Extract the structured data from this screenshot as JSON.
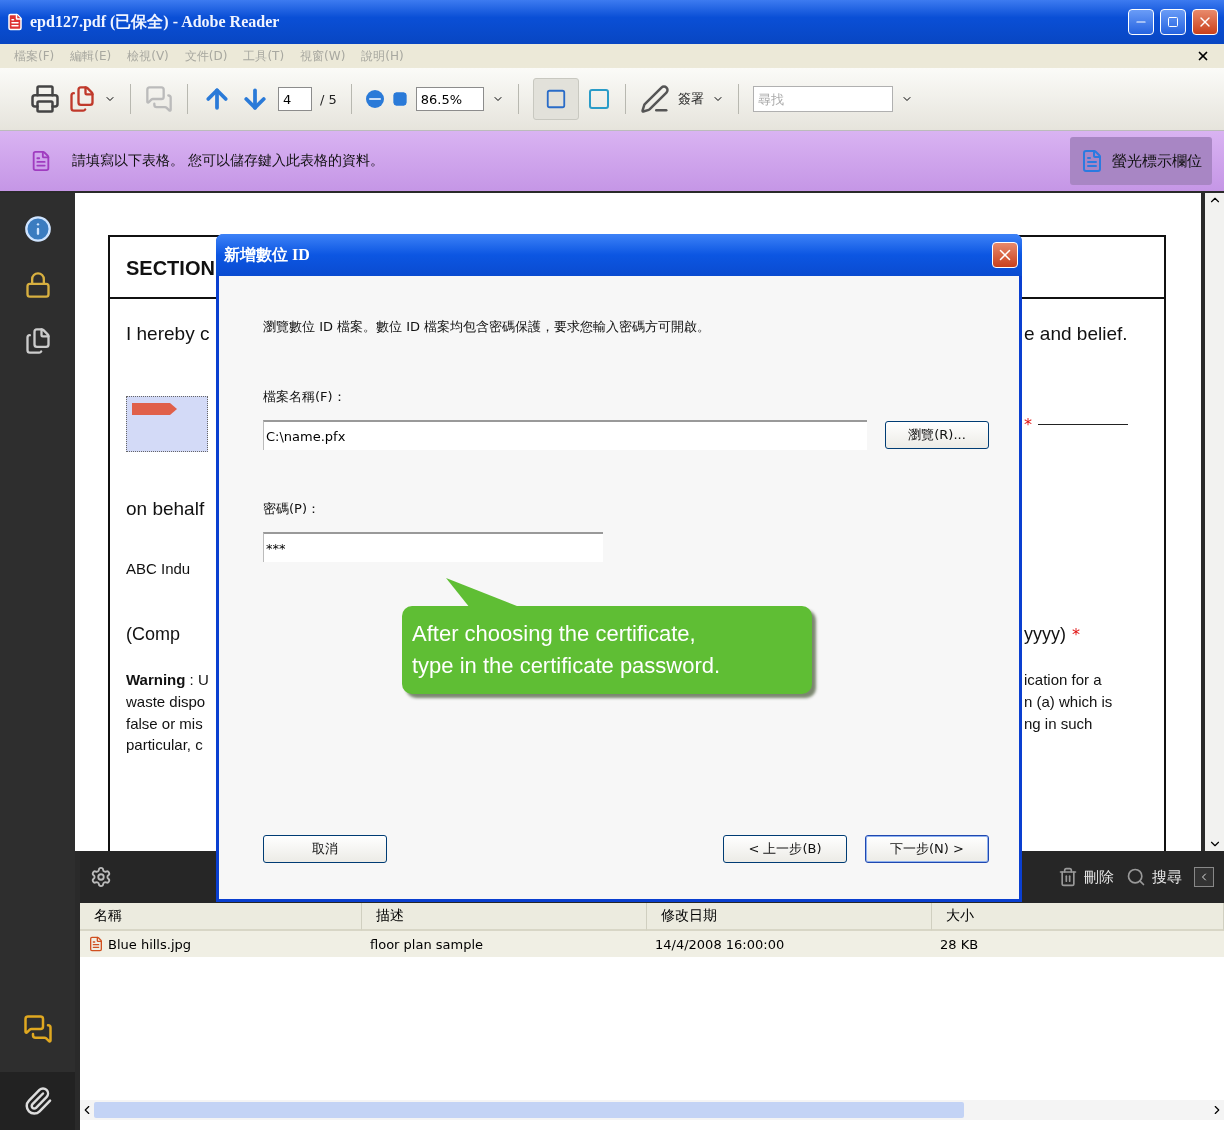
{
  "window": {
    "title": "epd127.pdf (已保全) - Adobe Reader"
  },
  "menu": [
    {
      "label": "檔案(F)",
      "disabled": true
    },
    {
      "label": "編輯(E)",
      "disabled": true
    },
    {
      "label": "檢視(V)",
      "disabled": true
    },
    {
      "label": "文件(D)",
      "disabled": true
    },
    {
      "label": "工具(T)",
      "disabled": true
    },
    {
      "label": "視窗(W)",
      "disabled": true
    },
    {
      "label": "說明(H)",
      "disabled": true
    }
  ],
  "toolbar": {
    "page": "4",
    "page_count": "/ 5",
    "zoom": "86.5%",
    "sign": "簽署",
    "search_placeholder": "尋找"
  },
  "form_bar": {
    "message": "請填寫以下表格。 您可以儲存鍵入此表格的資料。",
    "highlight_button": "螢光標示欄位"
  },
  "document": {
    "heading": "SECTION",
    "line_1": "I hereby c",
    "line_1_end": "e and belief.",
    "behalf": "on behalf",
    "company": "ABC Indu",
    "company_label": "(Comp",
    "date_label": "yyyy)",
    "required_mark": "*",
    "warning": "**Warning** : U\nwaste dispo\nfalse or mis\nparticular, c",
    "warning_end": "ication for a\nn (a) which is\nng in such"
  },
  "dialog": {
    "title": "新增數位 ID",
    "description": "瀏覽數位 ID 檔案。數位 ID 檔案均包含密碼保護，要求您輸入密碼方可開啟。",
    "file_label": "檔案名稱(F)：",
    "file_value": "C:\\name.pfx",
    "browse": "瀏覽(R)...",
    "password_label": "密碼(P)：",
    "password_value": "***",
    "cancel": "取消",
    "back": "< 上一步(B)",
    "next": "下一步(N) >"
  },
  "callout": {
    "text": "After choosing the certificate,\ntype in the certificate password."
  },
  "attachments": {
    "actions": [
      "刪除",
      "搜尋"
    ],
    "columns": [
      "名稱",
      "描述",
      "修改日期",
      "大小"
    ],
    "rows": [
      {
        "name": "Blue hills.jpg",
        "description": "floor plan sample",
        "modified": "14/4/2008 16:00:00",
        "size": "28 KB",
        "selected": true
      }
    ]
  }
}
